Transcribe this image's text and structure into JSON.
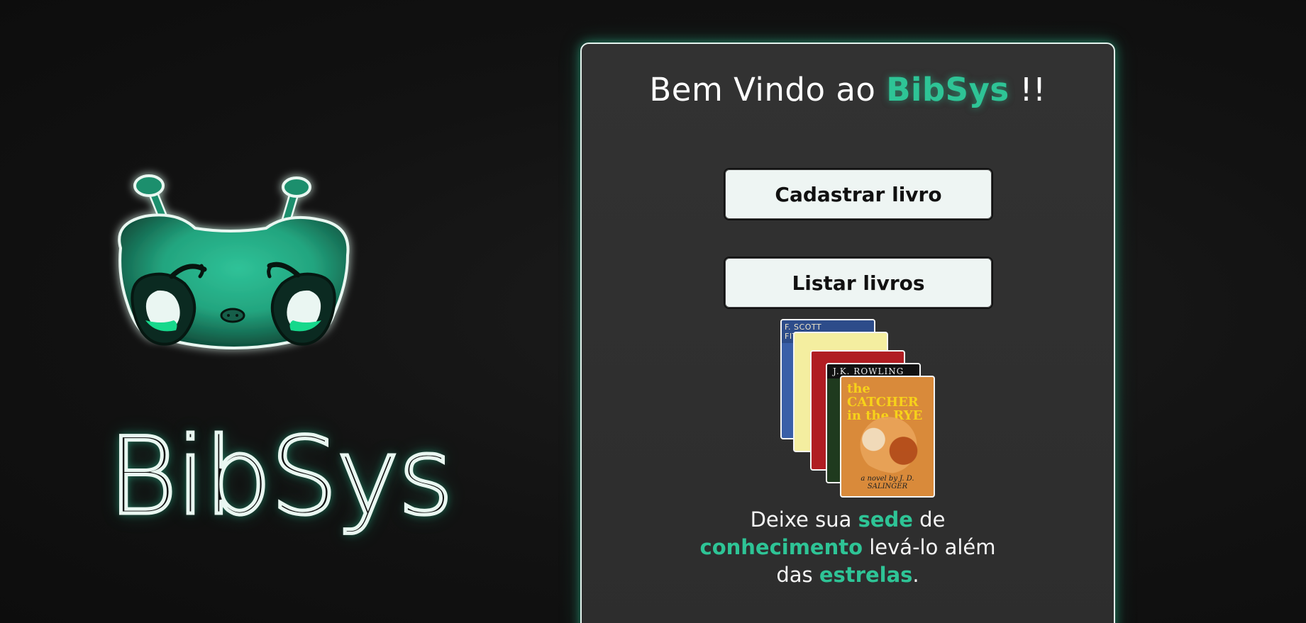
{
  "brand": {
    "name": "BibSys",
    "accent_color": "#2ec496"
  },
  "card": {
    "welcome": {
      "prefix": "Bem Vindo ao ",
      "highlight": "BibSys",
      "suffix": " !!"
    },
    "buttons": {
      "register_label": "Cadastrar livro",
      "list_label": "Listar livros"
    },
    "books": [
      {
        "cover_text": "F. SCOTT FITZGERALD"
      },
      {
        "cover_text": ""
      },
      {
        "cover_text": ""
      },
      {
        "cover_text": "J.K. ROWLING"
      },
      {
        "cover_text": "the CATCHER in the RYE",
        "author_text": "a novel by J. D. SALINGER"
      }
    ],
    "quote": {
      "w1": "Deixe sua ",
      "h1": "sede",
      "w2": " de",
      "h2": "conhecimento",
      "w3": " levá-lo além",
      "w4": "das ",
      "h3": "estrelas",
      "w5": "."
    }
  }
}
